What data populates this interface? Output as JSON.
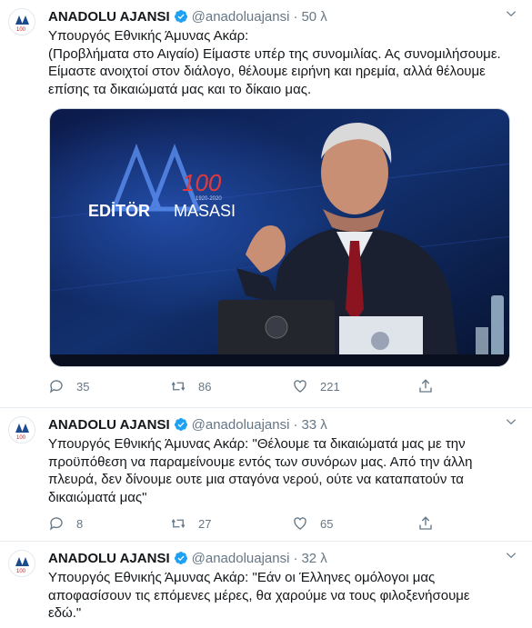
{
  "tweets": [
    {
      "author": {
        "name": "ANADOLU AJANSI",
        "handle": "@anadoluajansi"
      },
      "time": "50 λ",
      "lines": [
        "Υπουργός Εθνικής Άμυνας Ακάρ:",
        "(Προβλήματα στο Αιγαίο) Είμαστε υπέρ της συνομιλίας. Ας συνομιλήσουμε.",
        "Είμαστε ανοιχτοί στον διάλογο, θέλουμε ειρήνη και ηρεμία, αλλά θέλουμε",
        "επίσης τα δικαιώματά μας και το δίκαιο μας."
      ],
      "media": {
        "backdrop_logo": "AA",
        "backdrop_100": "100",
        "backdrop_years": "1920-2020",
        "backdrop_text_1": "EDİTÖR",
        "backdrop_text_2": "MASASI"
      },
      "stats": {
        "replies": "35",
        "retweets": "86",
        "likes": "221"
      }
    },
    {
      "author": {
        "name": "ANADOLU AJANSI",
        "handle": "@anadoluajansi"
      },
      "time": "33 λ",
      "lines": [
        "Υπουργός Εθνικής Άμυνας Ακάρ: \"Θέλουμε τα δικαιώματά μας με την",
        "προϋπόθεση να παραμείνουμε εντός των συνόρων μας. Από την άλλη",
        "πλευρά, δεν δίνουμε ουτε μια σταγόνα νερού, ούτε να καταπατούν τα",
        "δικαιώματά μας\""
      ],
      "stats": {
        "replies": "8",
        "retweets": "27",
        "likes": "65"
      }
    },
    {
      "author": {
        "name": "ANADOLU AJANSI",
        "handle": "@anadoluajansi"
      },
      "time": "32 λ",
      "lines": [
        "Υπουργός Εθνικής Άμυνας Ακάρ: \"Εάν οι Έλληνες ομόλογοι μας",
        "αποφασίσουν τις επόμενες μέρες, θα χαρούμε να τους φιλοξενήσουμε",
        "εδώ.\""
      ]
    }
  ],
  "avatar_logo": {
    "mark": "AA",
    "sub": "100"
  },
  "separator": "·",
  "colors": {
    "text": "#14171a",
    "secondary": "#657786",
    "verified": "#1da1f2",
    "border": "#e6ecf0",
    "aa_blue": "#1e4b8e",
    "aa_red": "#d71920"
  }
}
